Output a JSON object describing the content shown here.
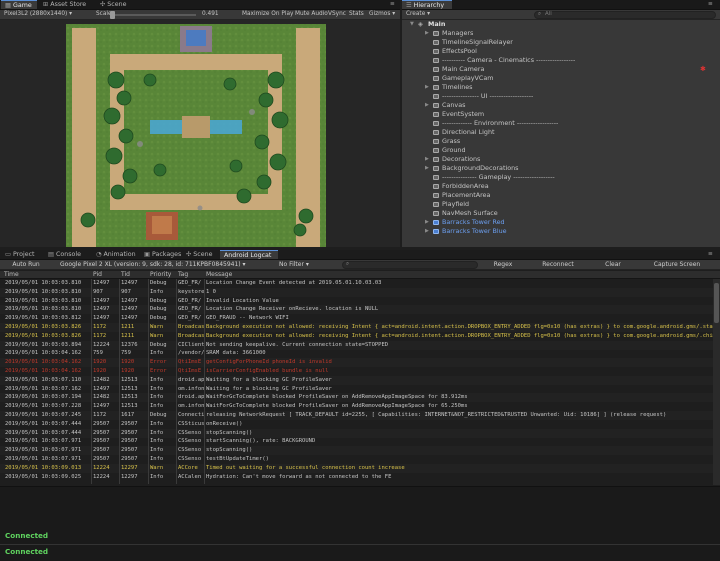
{
  "left_tabs": {
    "game": "Game",
    "asset_store": "Asset Store",
    "scene": "Scene"
  },
  "game_toolbar": {
    "resolution": "Pixel3L2 (2880x1440)",
    "scale_label": "Scale",
    "scale_value": "0.491",
    "maximize_on_play": "Maximize On Play",
    "mute_audio": "Mute Audio",
    "vsync": "VSync",
    "stats": "Stats",
    "gizmos": "Gizmos"
  },
  "game_level": {
    "colors": {
      "grass": "#5d8a3a",
      "dirt": "#c9a97a",
      "water": "#4aa8d8",
      "tree": "#2f6b2f",
      "tower_red": "#a85a3a",
      "tower_blue": "#4d7bbf"
    }
  },
  "hierarchy": {
    "tab": "Hierarchy",
    "create": "Create",
    "search_placeholder": "All",
    "scene_name": "Main",
    "items": [
      {
        "label": "Managers",
        "expand": true
      },
      {
        "label": "TimelineSignalRelayer",
        "expand": false
      },
      {
        "label": "EffectsPool",
        "expand": false
      },
      {
        "label": "---------- Camera - Cinematics -----------------",
        "expand": false
      },
      {
        "label": "Main Camera",
        "expand": false
      },
      {
        "label": "GameplayVCam",
        "expand": false
      },
      {
        "label": "Timelines",
        "expand": true
      },
      {
        "label": "---------------- UI -------------------",
        "expand": false
      },
      {
        "label": "Canvas",
        "expand": true
      },
      {
        "label": "EventSystem",
        "expand": false
      },
      {
        "label": "------------- Environment ------------------",
        "expand": false
      },
      {
        "label": "Directional Light",
        "expand": false
      },
      {
        "label": "Grass",
        "expand": false
      },
      {
        "label": "Ground",
        "expand": false
      },
      {
        "label": "Decorations",
        "expand": true
      },
      {
        "label": "BackgroundDecorations",
        "expand": true
      },
      {
        "label": "--------------- Gameplay ------------------",
        "expand": false
      },
      {
        "label": "ForbiddenArea",
        "expand": false
      },
      {
        "label": "PlacementArea",
        "expand": false
      },
      {
        "label": "Playfield",
        "expand": false
      },
      {
        "label": "NavMesh Surface",
        "expand": false
      },
      {
        "label": "Barracks Tower Red",
        "expand": true,
        "prefab": true
      },
      {
        "label": "Barracks Tower Blue",
        "expand": true,
        "prefab": true
      }
    ]
  },
  "bottom_tabs": {
    "project": "Project",
    "console": "Console",
    "animation": "Animation",
    "packages": "Packages",
    "scene": "Scene",
    "android_logcat": "Android Logcat"
  },
  "logcat_toolbar": {
    "auto_run": "Auto Run",
    "device": "Google Pixel 2 XL (version: 9, sdk: 28, id: 711KPBF0845941)",
    "filter": "No Filter",
    "regex": "Regex",
    "reconnect": "Reconnect",
    "clear": "Clear",
    "capture": "Capture Screen"
  },
  "log_columns": {
    "time": "Time",
    "pid": "Pid",
    "tid": "Tid",
    "priority": "Priority",
    "tag": "Tag",
    "message": "Message"
  },
  "colors": {
    "info": "#c4c4c4",
    "warn": "#d8c24a",
    "error": "#c0392b",
    "connected": "#5fd35f"
  },
  "logs": [
    {
      "time": "2019/05/01 10:03:03.810",
      "pid": "12497",
      "tid": "12497",
      "priority": "Debug",
      "tag": "GEO_FR/",
      "message": "Location Change Event detected at 2019.05.01.10.03.03",
      "level": "info"
    },
    {
      "time": "2019/05/01 10:03:03.810",
      "pid": "907",
      "tid": "907",
      "priority": "Info",
      "tag": "keystore",
      "message": "1 0",
      "level": "info"
    },
    {
      "time": "2019/05/01 10:03:03.810",
      "pid": "12497",
      "tid": "12497",
      "priority": "Debug",
      "tag": "GEO_FR/",
      "message": "Invalid Location Value",
      "level": "info"
    },
    {
      "time": "2019/05/01 10:03:03.810",
      "pid": "12497",
      "tid": "12497",
      "priority": "Debug",
      "tag": "GEO_FR/",
      "message": "Location Change Receiver onRecieve. location is NULL",
      "level": "info"
    },
    {
      "time": "2019/05/01 10:03:03.812",
      "pid": "12497",
      "tid": "12497",
      "priority": "Debug",
      "tag": "GEO_FR/",
      "message": "GEO_FRAUD -- Network WIFI",
      "level": "info"
    },
    {
      "time": "2019/05/01 10:03:03.826",
      "pid": "1172",
      "tid": "1211",
      "priority": "Warn",
      "tag": "Broadcas",
      "message": "Background execution not allowed: receiving Intent { act=android.intent.action.DROPBOX_ENTRY_ADDED flg=0x10 (has extras) } to com.google.android.gms/.stats.service.D",
      "level": "warn"
    },
    {
      "time": "2019/05/01 10:03:03.826",
      "pid": "1172",
      "tid": "1211",
      "priority": "Warn",
      "tag": "Broadcas",
      "message": "Background execution not allowed: receiving Intent { act=android.intent.action.DROPBOX_ENTRY_ADDED flg=0x10 (has extras) } to com.google.android.gms/.chimera.GmsI",
      "level": "warn"
    },
    {
      "time": "2019/05/01 10:03:03.894",
      "pid": "12224",
      "tid": "12376",
      "priority": "Debug",
      "tag": "CIClient",
      "message": "Not sending keepalive.  Current connection state=STOPPED",
      "level": "info"
    },
    {
      "time": "2019/05/01 10:03:04.162",
      "pid": "759",
      "tid": "759",
      "priority": "Info",
      "tag": "/vendor/",
      "message": "SRAM data: 3661000",
      "level": "info"
    },
    {
      "time": "2019/05/01 10:03:04.162",
      "pid": "1920",
      "tid": "1920",
      "priority": "Error",
      "tag": "QtiImsE",
      "message": "getConfigForPhoneId phoneId is invalid",
      "level": "error"
    },
    {
      "time": "2019/05/01 10:03:04.162",
      "pid": "1920",
      "tid": "1920",
      "priority": "Error",
      "tag": "QtiImsE",
      "message": "isCarrierConfigEnabled bundle is null",
      "level": "error"
    },
    {
      "time": "2019/05/01 10:03:07.110",
      "pid": "12482",
      "tid": "12513",
      "priority": "Info",
      "tag": "droid.ap",
      "message": "Waiting for a blocking GC ProfileSaver",
      "level": "info"
    },
    {
      "time": "2019/05/01 10:03:07.162",
      "pid": "12497",
      "tid": "12513",
      "priority": "Info",
      "tag": "om.infon",
      "message": "Waiting for a blocking GC ProfileSaver",
      "level": "info"
    },
    {
      "time": "2019/05/01 10:03:07.194",
      "pid": "12482",
      "tid": "12513",
      "priority": "Info",
      "tag": "droid.ap",
      "message": "WaitForGcToComplete blocked ProfileSaver on AddRemoveAppImageSpace for 83.912ms",
      "level": "info"
    },
    {
      "time": "2019/05/01 10:03:07.228",
      "pid": "12497",
      "tid": "12513",
      "priority": "Info",
      "tag": "om.infon",
      "message": "WaitForGcToComplete blocked ProfileSaver on AddRemoveAppImageSpace for 65.250ms",
      "level": "info"
    },
    {
      "time": "2019/05/01 10:03:07.245",
      "pid": "1172",
      "tid": "1617",
      "priority": "Debug",
      "tag": "Connecti",
      "message": "releasing NetworkRequest [ TRACK_DEFAULT id=2255, [ Capabilities: INTERNET&NOT_RESTRICTED&TRUSTED Unwanted:  Uid: 10186] ] (release request)",
      "level": "info"
    },
    {
      "time": "2019/05/01 10:03:07.444",
      "pid": "29507",
      "tid": "29507",
      "priority": "Info",
      "tag": "CSSticus",
      "message": "onReceive()",
      "level": "info"
    },
    {
      "time": "2019/05/01 10:03:07.444",
      "pid": "29507",
      "tid": "29507",
      "priority": "Info",
      "tag": "CSSenso",
      "message": "stopScanning()",
      "level": "info"
    },
    {
      "time": "2019/05/01 10:03:07.971",
      "pid": "29507",
      "tid": "29507",
      "priority": "Info",
      "tag": "CSSenso",
      "message": "startScanning(), rate: BACKGROUND",
      "level": "info"
    },
    {
      "time": "2019/05/01 10:03:07.971",
      "pid": "29507",
      "tid": "29507",
      "priority": "Info",
      "tag": "CSSenso",
      "message": "stopScanning()",
      "level": "info"
    },
    {
      "time": "2019/05/01 10:03:07.971",
      "pid": "29507",
      "tid": "29507",
      "priority": "Info",
      "tag": "CSSenso",
      "message": "testBtUpdateTimer()",
      "level": "info"
    },
    {
      "time": "2019/05/01 10:03:09.013",
      "pid": "12224",
      "tid": "12297",
      "priority": "Warn",
      "tag": "ACCore",
      "message": "Timed out waiting for a successful connection count increase",
      "level": "warn"
    },
    {
      "time": "2019/05/01 10:03:09.025",
      "pid": "12224",
      "tid": "12297",
      "priority": "Info",
      "tag": "ACCalen",
      "message": "Hydration: Can't move forward as not connected to the FE",
      "level": "info"
    }
  ],
  "status": {
    "connected_1": "Connected",
    "connected_2": "Connected"
  }
}
